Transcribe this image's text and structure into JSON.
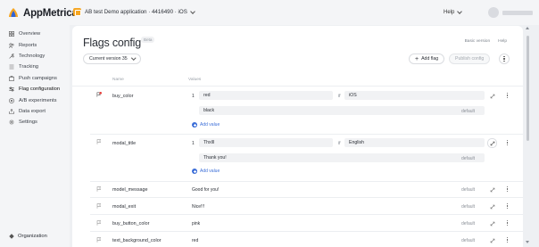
{
  "header": {
    "brand": "AppMetrica",
    "app_selector": "AB test Demo application · 4416490 · iOS",
    "help_label": "Help",
    "user_name": ""
  },
  "sidebar": {
    "items": [
      {
        "label": "Overview",
        "icon": "grid-icon"
      },
      {
        "label": "Reports",
        "icon": "people-icon"
      },
      {
        "label": "Technology",
        "icon": "wrench-icon"
      },
      {
        "label": "Tracking",
        "icon": "list-icon"
      },
      {
        "label": "Push campaigns",
        "icon": "push-icon"
      },
      {
        "label": "Flag configuration",
        "icon": "toggle-icon",
        "active": true
      },
      {
        "label": "A/B experiments",
        "icon": "flask-icon"
      },
      {
        "label": "Data export",
        "icon": "export-icon"
      },
      {
        "label": "Settings",
        "icon": "gear-icon"
      }
    ],
    "organization": "Organization"
  },
  "page": {
    "title": "Flags config",
    "badge": "Beta",
    "links": [
      "Basic version",
      "Help"
    ],
    "version_select": "Current version 35",
    "add_flag": "Add flag",
    "publish": "Publish config"
  },
  "table": {
    "columns": [
      "Name",
      "Values"
    ],
    "add_value_label": "Add value",
    "if_label": "if",
    "default_label": "default",
    "rows": [
      {
        "name": "buy_color",
        "conditions": [
          {
            "index": "1",
            "value": "red",
            "condition": "iOS"
          }
        ],
        "default": "black"
      },
      {
        "name": "modal_title",
        "conditions": [
          {
            "index": "1",
            "value": "Thxlll",
            "condition": "English"
          }
        ],
        "default": "Thank you!"
      },
      {
        "name": "model_message",
        "default": "Good for you!"
      },
      {
        "name": "modal_exit",
        "default": "Nice!!!"
      },
      {
        "name": "buy_button_color",
        "default": "pink"
      },
      {
        "name": "text_background_color",
        "default": "red"
      }
    ]
  },
  "colors": {
    "accent_blue": "#3d6fd8",
    "badge_orange": "#f5a623",
    "warning_red": "#e53935"
  }
}
